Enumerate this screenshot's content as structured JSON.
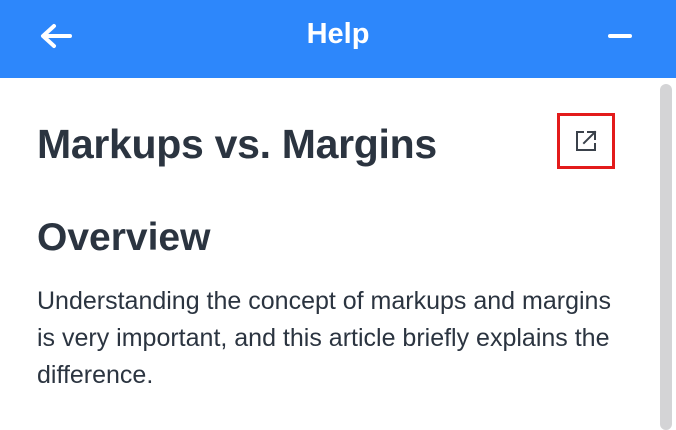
{
  "header": {
    "title": "Help",
    "back_icon": "arrow-left-icon",
    "minimize_icon": "minus-icon",
    "background_color": "#2d87fb"
  },
  "article": {
    "title": "Markups vs. Margins",
    "external_link_icon": "external-link-icon",
    "highlight_color": "#e31b1b",
    "sections": [
      {
        "heading": "Overview",
        "body": "Understanding the concept of markups and margins is very important, and this article briefly explains the difference."
      }
    ]
  },
  "colors": {
    "text": "#2b3440",
    "scrollbar_thumb": "#d4d4d6"
  }
}
